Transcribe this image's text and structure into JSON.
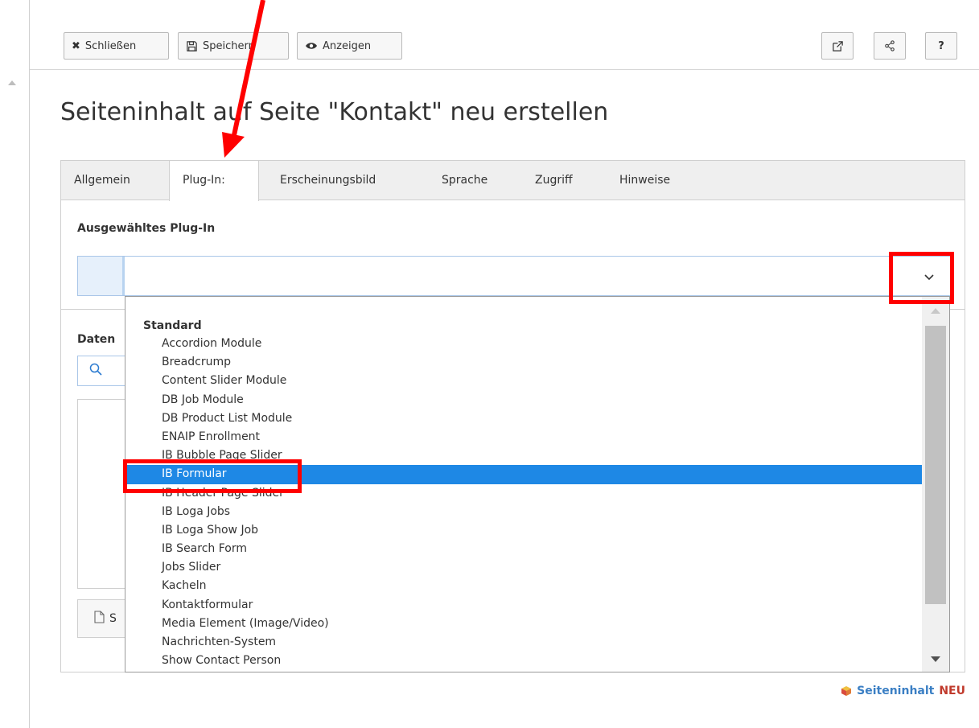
{
  "toolbar": {
    "close_label": "Schließen",
    "save_label": "Speichern",
    "view_label": "Anzeigen",
    "help_label": "?"
  },
  "page": {
    "title": "Seiteninhalt auf Seite \"Kontakt\" neu erstellen"
  },
  "tabs": [
    {
      "label": "Allgemein"
    },
    {
      "label": "Plug-In:"
    },
    {
      "label": "Erscheinungsbild"
    },
    {
      "label": "Sprache"
    },
    {
      "label": "Zugriff"
    },
    {
      "label": "Hinweise"
    }
  ],
  "plugin": {
    "section_label": "Ausgewähltes Plug-In",
    "selected_value": ""
  },
  "data_section": {
    "label": "Daten",
    "new_button_label": "S"
  },
  "dropdown": {
    "group": "Standard",
    "selected_index": 7,
    "items": [
      {
        "label": "Accordion Module"
      },
      {
        "label": "Breadcrump"
      },
      {
        "label": "Content Slider Module"
      },
      {
        "label": "DB Job Module"
      },
      {
        "label": "DB Product List Module"
      },
      {
        "label": "ENAIP Enrollment"
      },
      {
        "label": "IB Bubble Page Slider"
      },
      {
        "label": "IB Formular"
      },
      {
        "label": "IB Header Page Slider"
      },
      {
        "label": "IB Loga Jobs"
      },
      {
        "label": "IB Loga Show Job"
      },
      {
        "label": "IB Search Form"
      },
      {
        "label": "Jobs Slider"
      },
      {
        "label": "Kacheln"
      },
      {
        "label": "Kontaktformular"
      },
      {
        "label": "Media Element (Image/Video)"
      },
      {
        "label": "Nachrichten-System"
      },
      {
        "label": "Show Contact Person"
      }
    ]
  },
  "footer": {
    "label": "Seiteninhalt",
    "badge": "NEU"
  },
  "colors": {
    "selection": "#1e88e5",
    "annotation": "#ff0000",
    "footer_link": "#3b7fc4",
    "footer_badge": "#c0392b"
  }
}
